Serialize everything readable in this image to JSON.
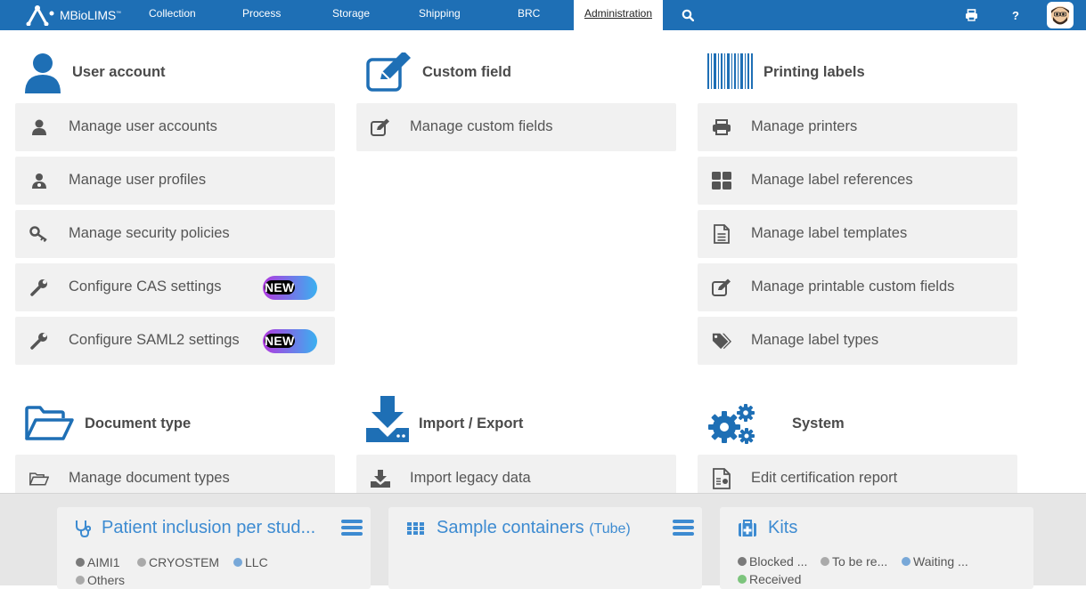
{
  "app": {
    "logo_text": "MBioLIMS",
    "logo_tm": "™"
  },
  "nav": {
    "items": [
      {
        "label": "Collection"
      },
      {
        "label": "Process"
      },
      {
        "label": "Storage"
      },
      {
        "label": "Shipping"
      },
      {
        "label": "BRC"
      },
      {
        "label": "Administration",
        "active": true
      }
    ],
    "icons": [
      "search-icon",
      "print-icon",
      "help-icon",
      "avatar"
    ],
    "help_label": "?"
  },
  "sections": {
    "user_account": {
      "title": "User account",
      "items": [
        {
          "label": "Manage user accounts",
          "icon": "user-icon"
        },
        {
          "label": "Manage user profiles",
          "icon": "user-profile-icon"
        },
        {
          "label": "Manage security policies",
          "icon": "key-icon"
        },
        {
          "label": "Configure CAS settings",
          "icon": "wrench-icon",
          "badge": "NEW"
        },
        {
          "label": "Configure SAML2 settings",
          "icon": "wrench-icon",
          "badge": "NEW"
        }
      ]
    },
    "custom_field": {
      "title": "Custom field",
      "items": [
        {
          "label": "Manage custom fields",
          "icon": "edit-icon"
        }
      ]
    },
    "printing_labels": {
      "title": "Printing labels",
      "items": [
        {
          "label": "Manage printers",
          "icon": "printer-icon"
        },
        {
          "label": "Manage label references",
          "icon": "grid-icon"
        },
        {
          "label": "Manage label templates",
          "icon": "document-icon"
        },
        {
          "label": "Manage printable custom fields",
          "icon": "edit-icon"
        },
        {
          "label": "Manage label types",
          "icon": "tags-icon"
        }
      ]
    },
    "document_type": {
      "title": "Document type",
      "items": [
        {
          "label": "Manage document types",
          "icon": "folder-open-icon"
        }
      ]
    },
    "import_export": {
      "title": "Import / Export",
      "items": [
        {
          "label": "Import legacy data",
          "icon": "download-icon"
        }
      ]
    },
    "system": {
      "title": "System",
      "items": [
        {
          "label": "Edit certification report",
          "icon": "certificate-icon"
        }
      ]
    }
  },
  "dashboard": {
    "widgets": [
      {
        "title": "Patient inclusion per stud...",
        "icon": "stethoscope-icon",
        "legend": [
          {
            "label": "AIMI1",
            "color": "#7a7a7a"
          },
          {
            "label": "CRYOSTEM",
            "color": "#aaaaaa"
          },
          {
            "label": "LLC",
            "color": "#78a8d8"
          },
          {
            "label": "Others",
            "color": "#aaaaaa"
          }
        ]
      },
      {
        "title": "Sample containers",
        "subtitle": "(Tube)",
        "icon": "grid-dots-icon",
        "legend": []
      },
      {
        "title": "Kits",
        "icon": "medical-kit-icon",
        "legend": [
          {
            "label": "Blocked ...",
            "color": "#7a7a7a"
          },
          {
            "label": "To be re...",
            "color": "#aaaaaa"
          },
          {
            "label": "Waiting ...",
            "color": "#78a8d8"
          },
          {
            "label": "Received",
            "color": "#7cc47c"
          }
        ]
      }
    ]
  },
  "colors": {
    "primary": "#1e6fb5",
    "widget_title": "#3d8bd1",
    "item_bg": "#f1f1f1"
  }
}
